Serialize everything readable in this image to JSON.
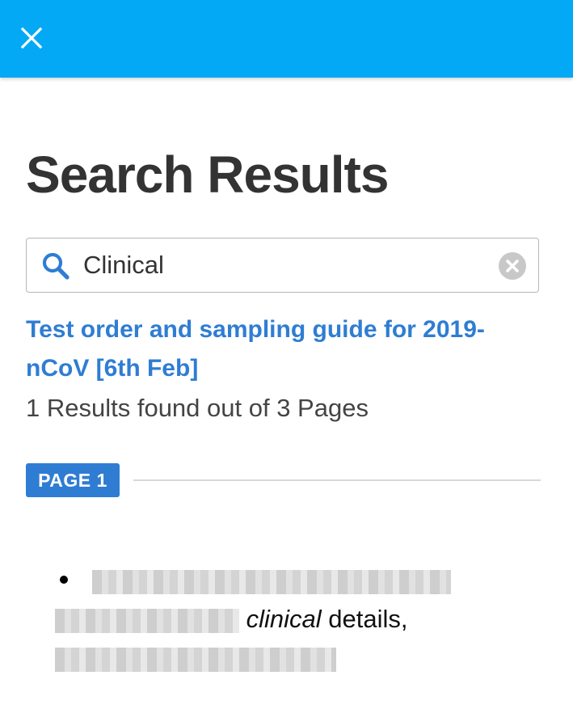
{
  "header": {
    "close_icon": "close-icon"
  },
  "page": {
    "title": "Search Results"
  },
  "search": {
    "value": "Clinical",
    "icon": "search-icon",
    "clear_icon": "clear-icon"
  },
  "result": {
    "title": "Test order and sampling guide for 2019-nCoV [6th Feb]",
    "summary": "1 Results found out of 3 Pages"
  },
  "page_group": {
    "badge": "PAGE 1"
  },
  "snippet": {
    "highlight": "clinical",
    "after": " details,"
  },
  "colors": {
    "appbar": "#03a9f4",
    "accent": "#2f7dd3",
    "title_text": "#333333"
  }
}
